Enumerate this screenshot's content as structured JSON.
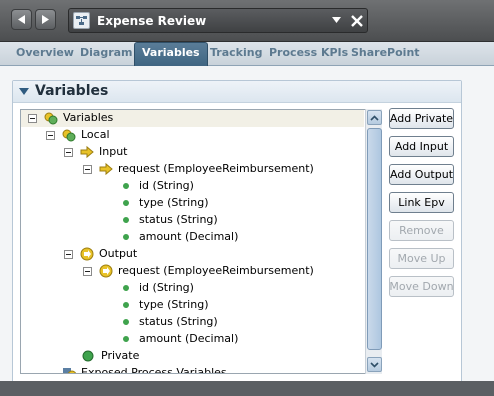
{
  "window": {
    "title": "Expense Review"
  },
  "tabs": [
    {
      "label": "Overview",
      "active": false
    },
    {
      "label": "Diagram",
      "active": false
    },
    {
      "label": "Variables",
      "active": true
    },
    {
      "label": "Tracking",
      "active": false
    },
    {
      "label": "Process KPIs",
      "active": false
    },
    {
      "label": "SharePoint",
      "active": false
    }
  ],
  "section": {
    "title": "Variables"
  },
  "tree": [
    {
      "label": "Variables",
      "icon": "variables-icon",
      "level": 0,
      "expanded": true,
      "selected": true
    },
    {
      "label": "Local",
      "icon": "local-icon",
      "level": 1,
      "expanded": true
    },
    {
      "label": "Input",
      "icon": "input-arrow-icon",
      "level": 2,
      "expanded": true
    },
    {
      "label": "request (EmployeeReimbursement)",
      "icon": "input-arrow-icon",
      "level": 3,
      "expanded": true
    },
    {
      "label": "id (String)",
      "icon": "field-dot-icon",
      "level": 4
    },
    {
      "label": "type (String)",
      "icon": "field-dot-icon",
      "level": 4
    },
    {
      "label": "status (String)",
      "icon": "field-dot-icon",
      "level": 4
    },
    {
      "label": "amount (Decimal)",
      "icon": "field-dot-icon",
      "level": 4
    },
    {
      "label": "Output",
      "icon": "output-arrow-icon",
      "level": 2,
      "expanded": true
    },
    {
      "label": "request (EmployeeReimbursement)",
      "icon": "output-arrow-icon",
      "level": 3,
      "expanded": true
    },
    {
      "label": "id (String)",
      "icon": "field-dot-icon",
      "level": 4
    },
    {
      "label": "type (String)",
      "icon": "field-dot-icon",
      "level": 4
    },
    {
      "label": "status (String)",
      "icon": "field-dot-icon",
      "level": 4
    },
    {
      "label": "amount (Decimal)",
      "icon": "field-dot-icon",
      "level": 4
    },
    {
      "label": "Private",
      "icon": "private-icon",
      "level": 2
    },
    {
      "label": "Exposed Process Variables",
      "icon": "exposed-vars-icon",
      "level": 1
    }
  ],
  "buttons": [
    {
      "label": "Add Private",
      "enabled": true
    },
    {
      "label": "Add Input",
      "enabled": true
    },
    {
      "label": "Add Output",
      "enabled": true
    },
    {
      "label": "Link Epv",
      "enabled": true
    },
    {
      "label": "Remove",
      "enabled": false
    },
    {
      "label": "Move Up",
      "enabled": false
    },
    {
      "label": "Move Down",
      "enabled": false
    }
  ],
  "colors": {
    "accent": "#3f6582",
    "tab_text": "#5d7a90",
    "field_dot": "#3fa34d",
    "input_arrow": "#e8c228",
    "output_arrow": "#e8c228"
  }
}
